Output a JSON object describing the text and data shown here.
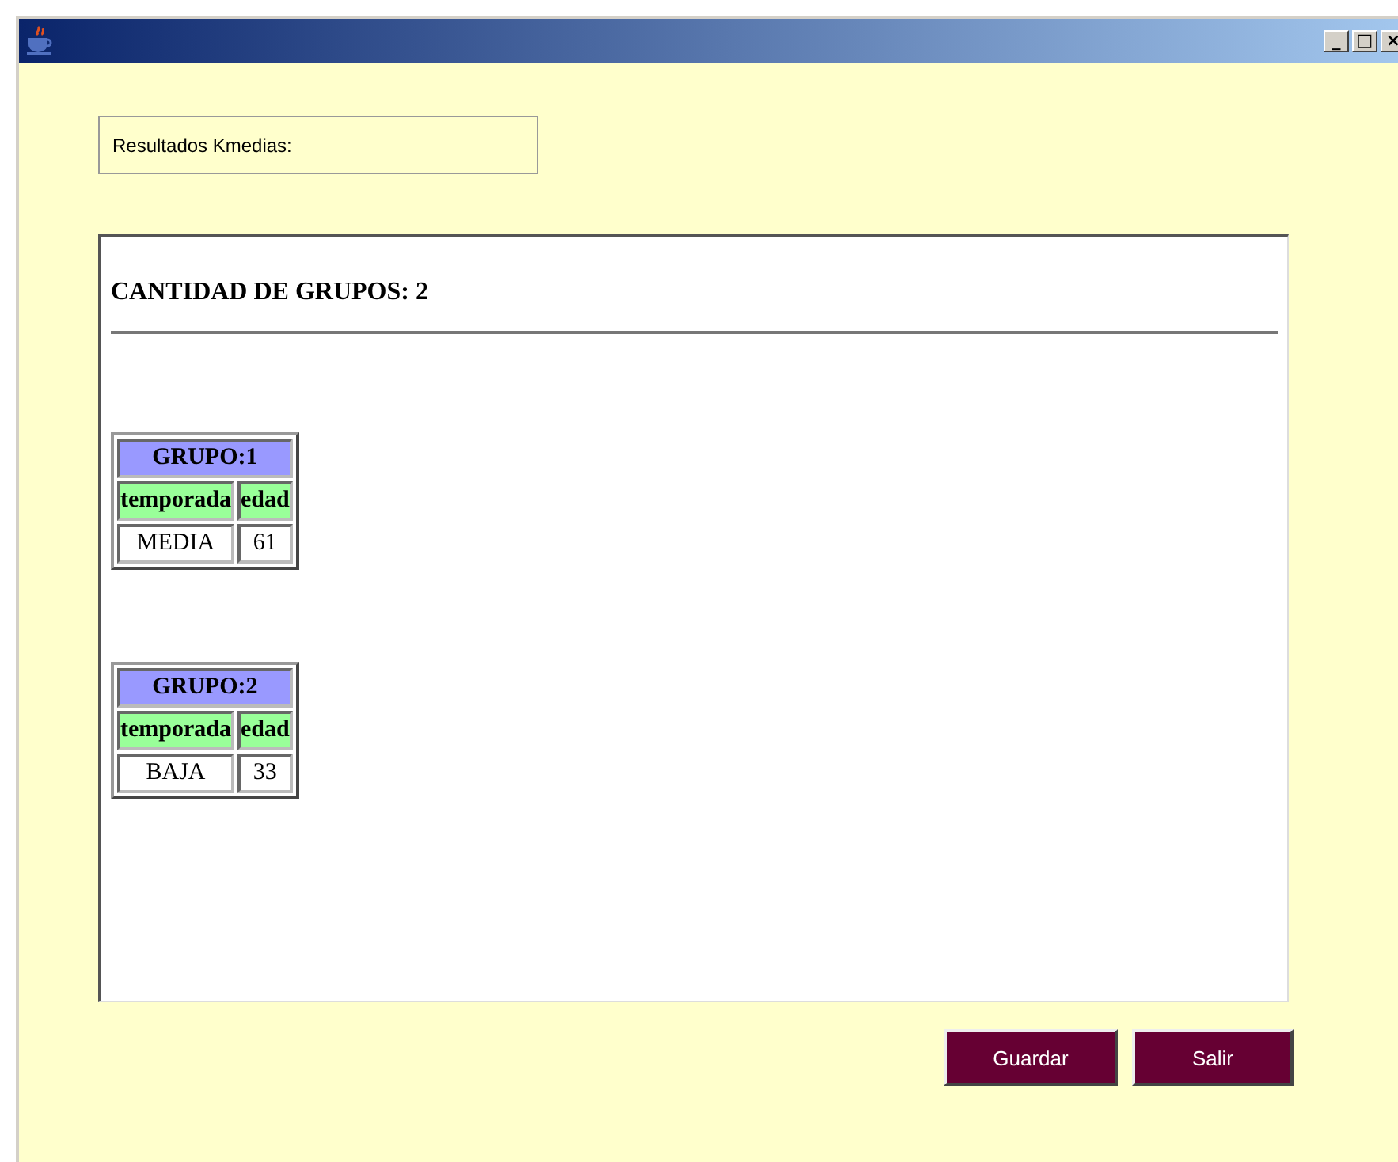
{
  "window": {
    "title_buttons": [
      "_",
      "□",
      "×"
    ]
  },
  "label": "Resultados Kmedias:",
  "result": {
    "heading": "CANTIDAD DE GRUPOS: 2",
    "groups": [
      {
        "title": "GRUPO:1",
        "columns": [
          "temporada",
          "edad"
        ],
        "rows": [
          [
            "MEDIA",
            "61"
          ]
        ]
      },
      {
        "title": "GRUPO:2",
        "columns": [
          "temporada",
          "edad"
        ],
        "rows": [
          [
            "BAJA",
            "33"
          ]
        ]
      }
    ]
  },
  "buttons": [
    "Guardar",
    "Salir"
  ]
}
